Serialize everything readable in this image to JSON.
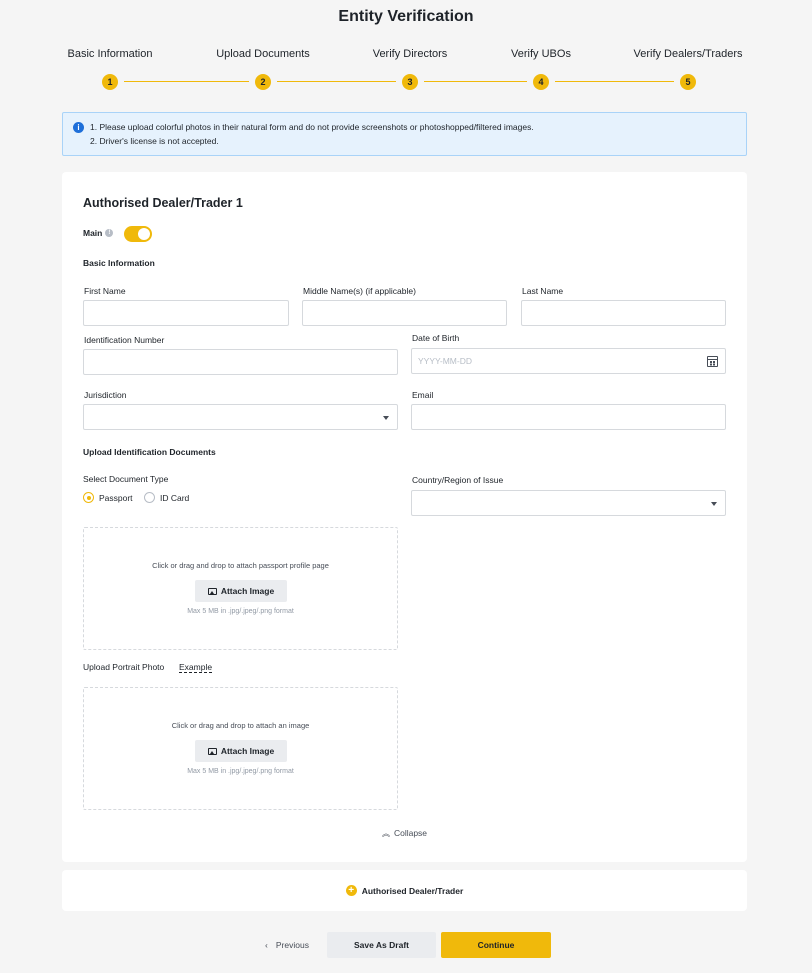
{
  "page": {
    "title": "Entity Verification"
  },
  "steps": [
    {
      "label": "Basic Information",
      "number": "1"
    },
    {
      "label": "Upload Documents",
      "number": "2"
    },
    {
      "label": "Verify Directors",
      "number": "3"
    },
    {
      "label": "Verify UBOs",
      "number": "4"
    },
    {
      "label": "Verify Dealers/Traders",
      "number": "5"
    }
  ],
  "notice": {
    "line1": "1. Please upload colorful photos in their natural form and do not provide screenshots or photoshopped/filtered images.",
    "line2": "2. Driver's license is not accepted."
  },
  "card": {
    "title": "Authorised Dealer/Trader 1",
    "main_label": "Main",
    "main_toggle_on": true,
    "basic_info_heading": "Basic Information",
    "fields": {
      "first_name": {
        "label": "First Name",
        "value": ""
      },
      "middle_name": {
        "label": "Middle Name(s) (if applicable)",
        "value": ""
      },
      "last_name": {
        "label": "Last Name",
        "value": ""
      },
      "id_number": {
        "label": "Identification Number",
        "value": ""
      },
      "dob": {
        "label": "Date of Birth",
        "placeholder": "YYYY-MM-DD"
      },
      "jurisdiction": {
        "label": "Jurisdiction",
        "value": ""
      },
      "email": {
        "label": "Email",
        "value": ""
      },
      "country": {
        "label": "Country/Region of Issue",
        "value": ""
      }
    },
    "upload_heading": "Upload Identification Documents",
    "doc_type_label": "Select Document Type",
    "doc_types": [
      {
        "label": "Passport",
        "selected": true
      },
      {
        "label": "ID Card",
        "selected": false
      }
    ],
    "passport_dropzone": {
      "text": "Click or drag and drop to attach passport profile page",
      "button": "Attach Image",
      "hint": "Max 5 MB in .jpg/.jpeg/.png format"
    },
    "portrait_label": "Upload Portrait Photo",
    "portrait_example": "Example",
    "portrait_dropzone": {
      "text": "Click or drag and drop to attach an image",
      "button": "Attach Image",
      "hint": "Max 5 MB in .jpg/.jpeg/.png format"
    },
    "collapse_label": "Collapse"
  },
  "add_dealer_label": "Authorised Dealer/Trader",
  "footer": {
    "previous": "Previous",
    "save_draft": "Save As Draft",
    "continue": "Continue"
  },
  "colors": {
    "accent": "#f0b90b",
    "notice_bg": "#e6f2fd",
    "info": "#1e6fd9"
  }
}
